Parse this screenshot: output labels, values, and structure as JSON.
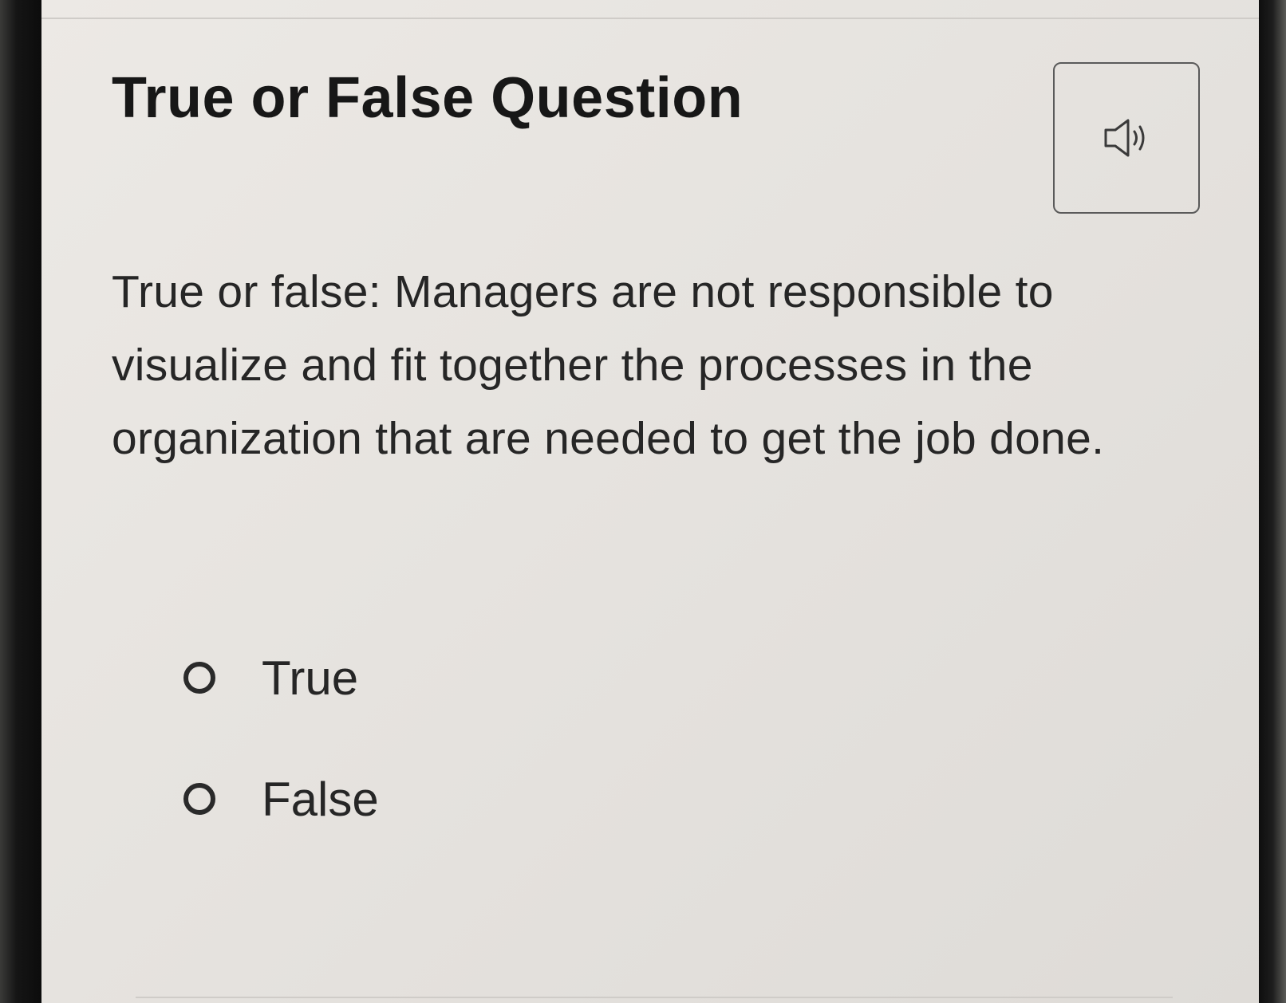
{
  "header": {
    "title": "True or False Question",
    "audio_icon": "speaker-icon"
  },
  "question": {
    "text": "True or false: Managers are not responsible to visualize and fit together the processes in the organization that are needed to get the job done."
  },
  "options": [
    {
      "label": "True",
      "selected": false
    },
    {
      "label": "False",
      "selected": false
    }
  ],
  "colors": {
    "background": "#e8e5e1",
    "text": "#171717",
    "border": "#5a5a5a"
  }
}
